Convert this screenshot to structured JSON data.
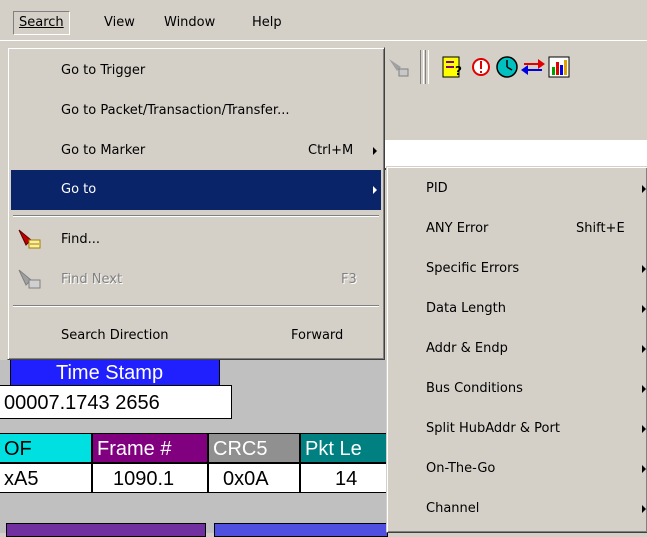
{
  "menubar": {
    "items": [
      "Search",
      "View",
      "Window",
      "Help"
    ]
  },
  "search_menu": {
    "items": [
      {
        "label": "Go to Trigger",
        "shortcut": ""
      },
      {
        "label": "Go to Packet/Transaction/Transfer...",
        "shortcut": ""
      },
      {
        "label": "Go to Marker",
        "shortcut": "Ctrl+M"
      },
      {
        "label": "Go to",
        "shortcut": ""
      },
      {
        "label": "Find...",
        "shortcut": ""
      },
      {
        "label": "Find Next",
        "shortcut": "F3"
      },
      {
        "label": "Search Direction",
        "shortcut": "Forward"
      }
    ]
  },
  "goto_submenu": {
    "items": [
      {
        "label": "PID",
        "shortcut": ""
      },
      {
        "label": "ANY Error",
        "shortcut": "Shift+E"
      },
      {
        "label": "Specific Errors",
        "shortcut": ""
      },
      {
        "label": "Data Length",
        "shortcut": ""
      },
      {
        "label": "Addr & Endp",
        "shortcut": ""
      },
      {
        "label": "Bus Conditions",
        "shortcut": ""
      },
      {
        "label": "Split HubAddr & Port",
        "shortcut": ""
      },
      {
        "label": "On-The-Go",
        "shortcut": ""
      },
      {
        "label": "Channel",
        "shortcut": ""
      }
    ]
  },
  "trace": {
    "time_stamp_header": "Time Stamp",
    "time_stamp_value": "00007.1743 2656",
    "fields": [
      {
        "header": "OF",
        "value": "xA5",
        "color": "#00e0e0"
      },
      {
        "header": "Frame #",
        "value": "1090.1",
        "color": "#800080"
      },
      {
        "header": "CRC5",
        "value": "0x0A",
        "color": "#909090"
      },
      {
        "header": "Pkt Le",
        "value": "14",
        "color": "#008080"
      }
    ],
    "time_stamp_color": "#2020ff"
  },
  "colors": {
    "menu_highlight": "#0a246a",
    "menu_background": "#d4d0c8"
  }
}
